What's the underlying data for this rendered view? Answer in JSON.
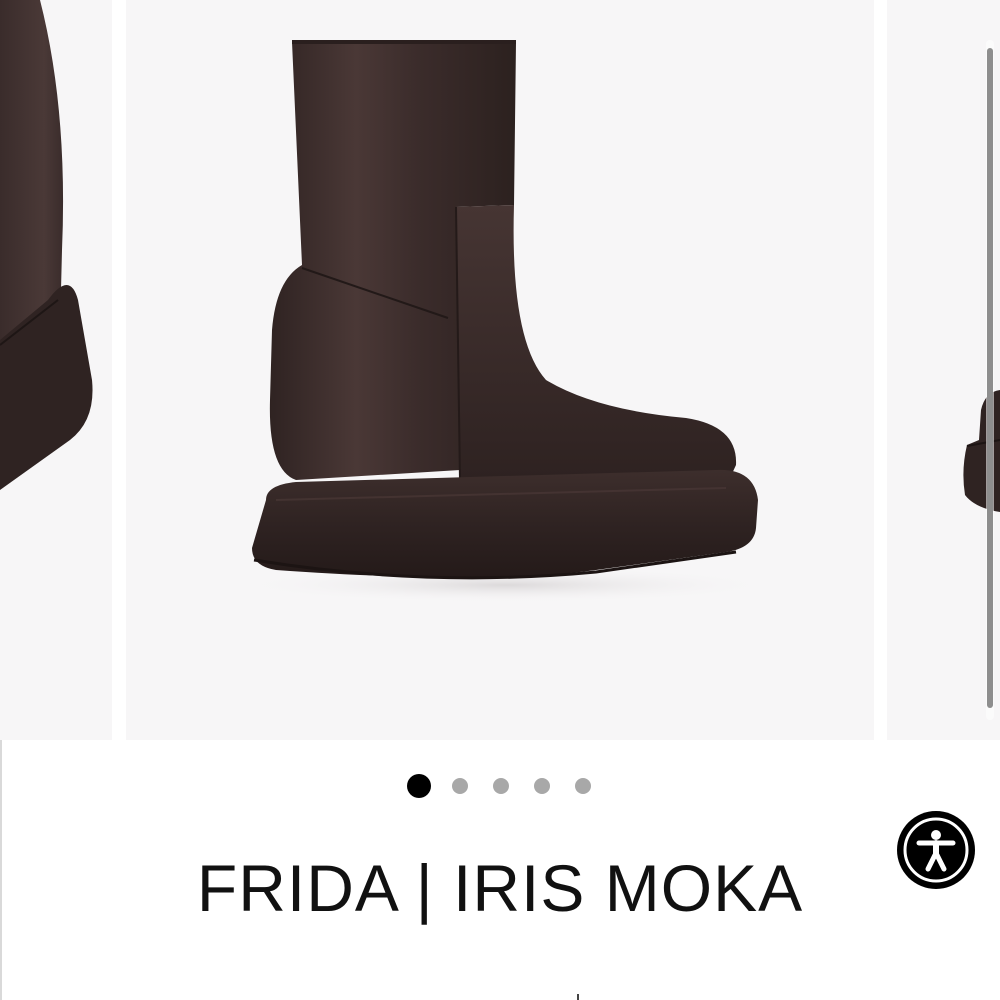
{
  "product": {
    "title": "FRIDA | IRIS MOKA"
  },
  "carousel": {
    "slide_count": 5,
    "active_index": 0,
    "colors": {
      "background": "#f7f6f7",
      "boot": "#3b2d2c",
      "boot_highlight": "#5a4745",
      "sole": "#2e2322"
    }
  },
  "pagination": {
    "active_color": "#000000",
    "inactive_color": "#a8a8a8"
  },
  "accessibility": {
    "icon": "accessibility-person-icon"
  }
}
